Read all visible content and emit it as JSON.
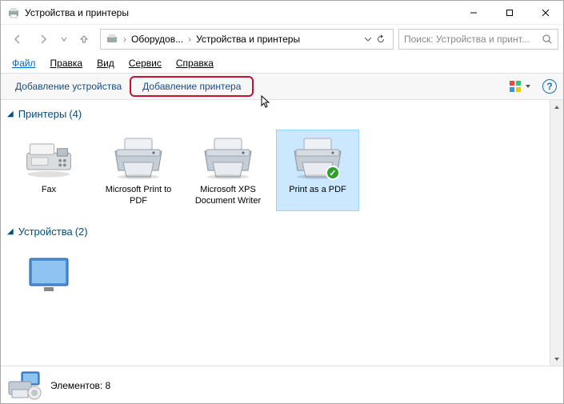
{
  "window": {
    "title": "Устройства и принтеры"
  },
  "nav": {
    "crumb1": "Оборудов...",
    "crumb2": "Устройства и принтеры"
  },
  "search": {
    "placeholder": "Поиск: Устройства и принт..."
  },
  "menu": {
    "file": "Файл",
    "edit": "Правка",
    "view": "Вид",
    "tools": "Сервис",
    "help": "Справка"
  },
  "commands": {
    "add_device": "Добавление устройства",
    "add_printer": "Добавление принтера"
  },
  "groups": {
    "printers": {
      "title": "Принтеры",
      "count": "(4)"
    },
    "devices": {
      "title": "Устройства",
      "count": "(2)"
    }
  },
  "items": {
    "fax": "Fax",
    "ms_print_pdf": "Microsoft Print to PDF",
    "ms_xps": "Microsoft XPS Document Writer",
    "print_as_pdf": "Print as a PDF"
  },
  "status": {
    "label": "Элементов:",
    "count": "8"
  }
}
